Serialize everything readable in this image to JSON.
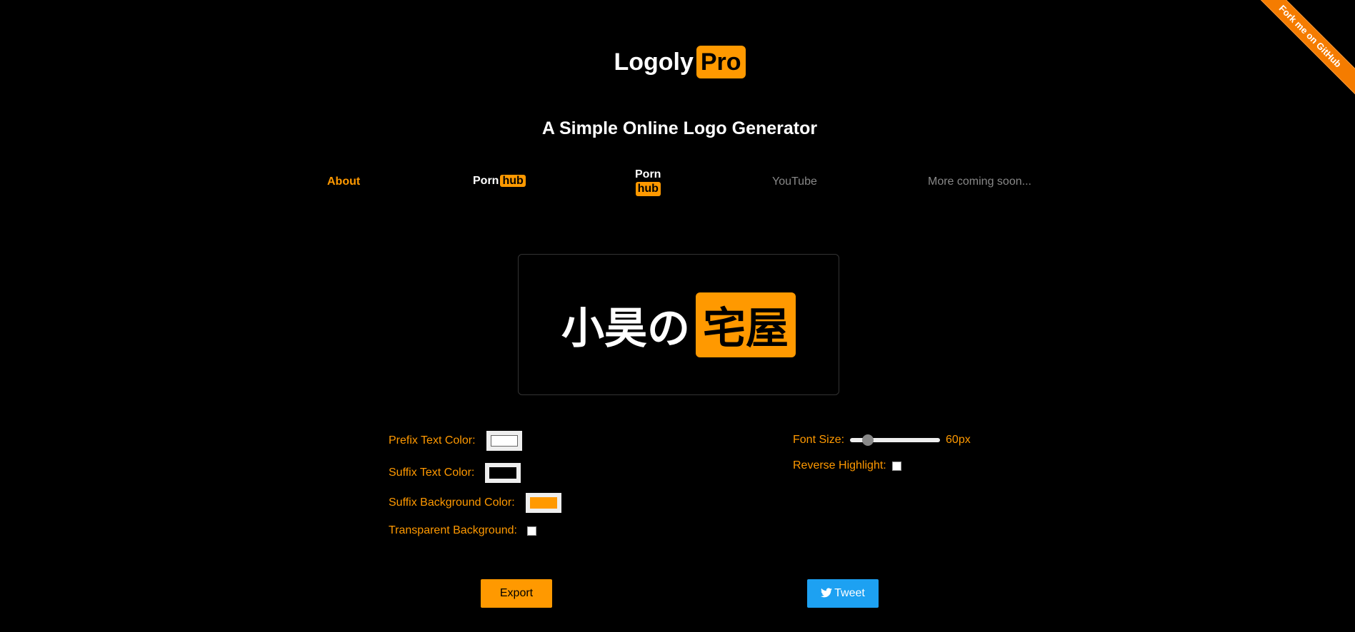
{
  "ribbon": {
    "label": "Fork me on GitHub"
  },
  "brand": {
    "name": "Logoly",
    "badge": "Pro"
  },
  "subtitle": "A Simple Online Logo Generator",
  "nav": {
    "about": "About",
    "pornhub_horizontal": {
      "prefix": "Porn",
      "suffix": "hub"
    },
    "pornhub_vertical": {
      "prefix": "Porn",
      "suffix": "hub"
    },
    "youtube": "YouTube",
    "more": "More coming soon..."
  },
  "preview": {
    "prefix": "小昊の",
    "suffix": "宅屋"
  },
  "controls": {
    "prefix_text_color": {
      "label": "Prefix Text Color:",
      "value": "#ffffff"
    },
    "suffix_text_color": {
      "label": "Suffix Text Color:",
      "value": "#000000"
    },
    "suffix_bg_color": {
      "label": "Suffix Background Color:",
      "value": "#ff9900"
    },
    "transparent_bg": {
      "label": "Transparent Background:",
      "checked": false
    },
    "font_size": {
      "label": "Font Size:",
      "value": 60,
      "display": "60px",
      "min": 0.0,
      "max": 300.0
    },
    "reverse_highlight": {
      "label": "Reverse Highlight:",
      "checked": false
    }
  },
  "buttons": {
    "export": "Export",
    "tweet": "Tweet"
  },
  "colors": {
    "accent": "#ff9900",
    "twitter": "#1da1f2",
    "muted": "#888888"
  }
}
